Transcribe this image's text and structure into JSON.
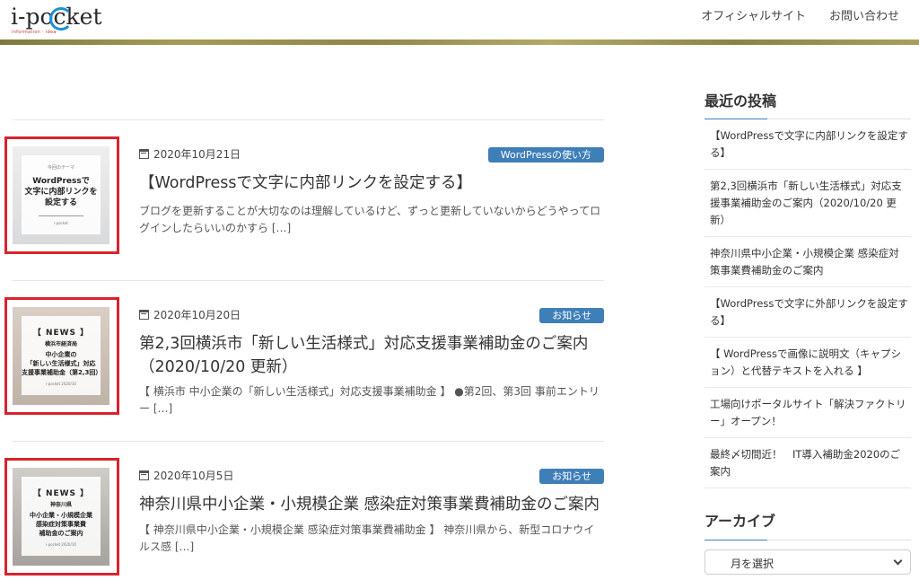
{
  "header": {
    "logo_text": "i-pocket",
    "logo_sub": "information · idea",
    "nav": [
      "オフィシャルサイト",
      "お問い合わせ"
    ]
  },
  "posts": [
    {
      "date": "2020年10月21日",
      "category": "WordPressの使い方",
      "title": "【WordPressで文字に内部リンクを設定する】",
      "excerpt": "ブログを更新することが大切なのは理解しているけど、ずっと更新していないからどうやってログインしたらいいのかすら […]",
      "thumb": {
        "kicker": "今回のテーマ",
        "title": "WordPressで\n文字に内部リンクを\n設定する",
        "foot": "i-pocket"
      }
    },
    {
      "date": "2020年10月20日",
      "category": "お知らせ",
      "title": "第2,3回横浜市「新しい生活様式」対応支援事業補助金のご案内（2020/10/20 更新）",
      "excerpt": "【 横浜市 中小企業の「新しい生活様式」対応支援事業補助金 】 ●第2回、第3回 事前エントリー […]",
      "thumb": {
        "news": "【 NEWS 】",
        "sub": "横浜市経済局",
        "title": "中小企業の\n「新しい生活様式」対応\n支援事業補助金（第2,3回）",
        "foot": "i-pocket 2020/10"
      }
    },
    {
      "date": "2020年10月5日",
      "category": "お知らせ",
      "title": "神奈川県中小企業・小規模企業 感染症対策事業費補助金のご案内",
      "excerpt": "【 神奈川県中小企業・小規模企業 感染症対策事業費補助金 】 神奈川県から、新型コロナウイルス感 […]",
      "thumb": {
        "news": "【 NEWS 】",
        "sub": "神奈川県",
        "title": "中小企業・小規模企業\n感染症対策事業費\n補助金のご案内",
        "foot": "i-pocket 2020/10"
      }
    }
  ],
  "sidebar": {
    "recent_heading": "最近の投稿",
    "recent": [
      "【WordPressで文字に内部リンクを設定する】",
      "第2,3回横浜市「新しい生活様式」対応支援事業補助金のご案内（2020/10/20 更新）",
      "神奈川県中小企業・小規模企業 感染症対策事業費補助金のご案内",
      "【WordPressで文字に外部リンクを設定する】",
      "【 WordPressで画像に説明文（キャプション）と代替テキストを入れる 】",
      "工場向けポータルサイト「解決ファクトリー」オープン！",
      "最終〆切間近！　IT導入補助金2020のご案内"
    ],
    "archive_heading": "アーカイブ",
    "archive_select": "月を選択"
  },
  "colors": {
    "accent": "#3f7fb8",
    "highlight_frame": "#d9232d"
  }
}
